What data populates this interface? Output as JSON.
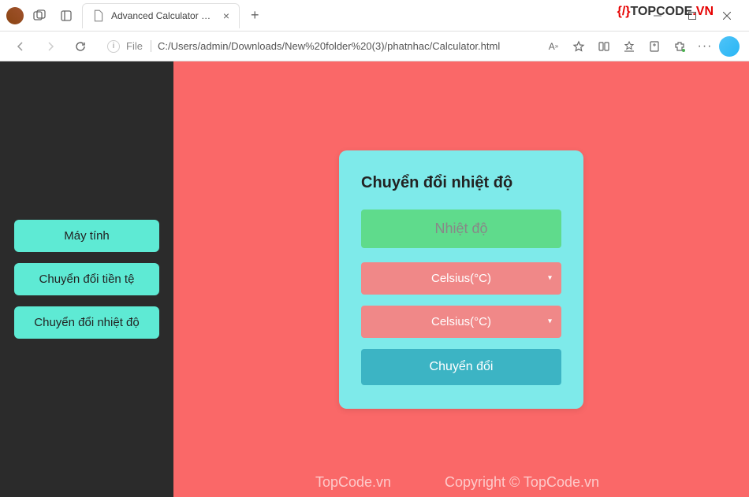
{
  "browser": {
    "tab_title": "Advanced Calculator with Curren",
    "url_label": "File",
    "url": "C:/Users/admin/Downloads/New%20folder%20(3)/phatnhac/Calculator.html",
    "read_aloud": "A⁹⁾"
  },
  "watermark": {
    "brand": "TOPCODE.VN",
    "footer_left": "TopCode.vn",
    "footer_right": "Copyright © TopCode.vn"
  },
  "sidebar": {
    "items": [
      {
        "label": "Máy tính"
      },
      {
        "label": "Chuyển đổi tiền tệ"
      },
      {
        "label": "Chuyển đổi nhiệt độ"
      }
    ]
  },
  "card": {
    "title": "Chuyển đổi nhiệt độ",
    "input_placeholder": "Nhiệt độ",
    "from_unit": "Celsius(°C)",
    "to_unit": "Celsius(°C)",
    "convert_label": "Chuyển đổi"
  }
}
